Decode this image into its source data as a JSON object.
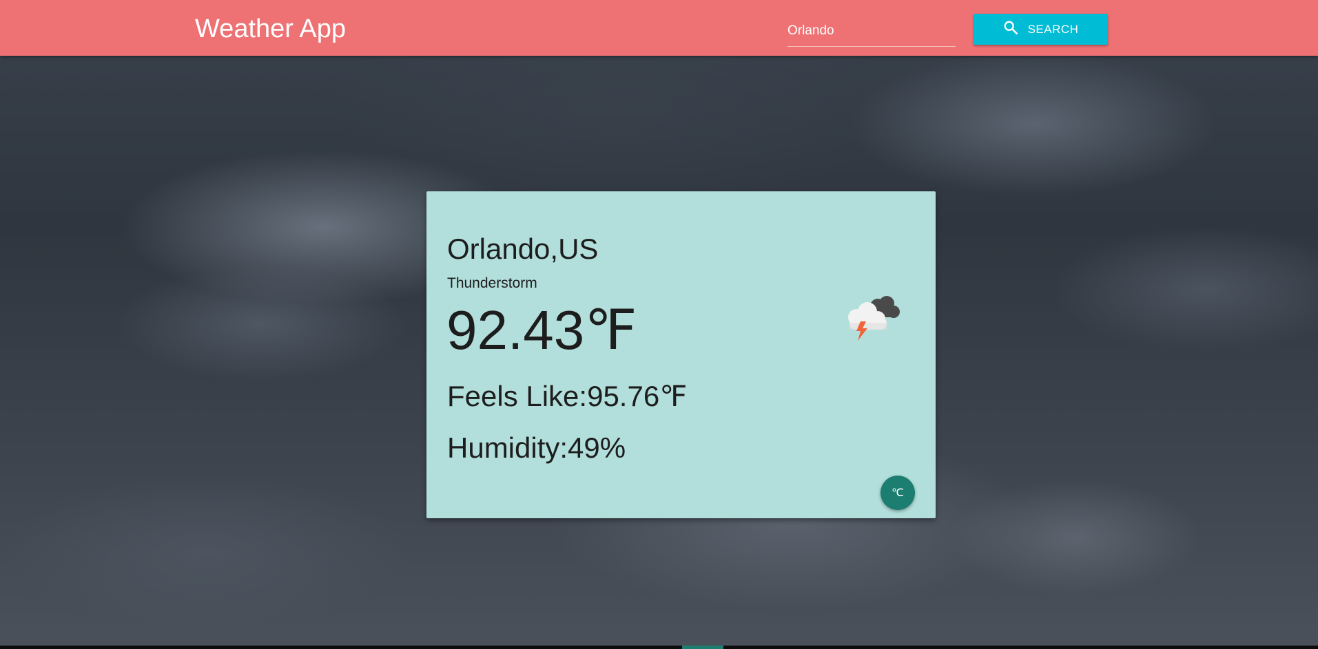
{
  "header": {
    "title": "Weather App",
    "search_value": "Orlando",
    "search_label": "SEARCH",
    "search_icon": "search-icon"
  },
  "weather": {
    "location": "Orlando,US",
    "condition": "Thunderstorm",
    "temperature": "92.43",
    "temp_unit": "℉",
    "feels_like_label": "Feels Like:",
    "feels_like_value": "95.76",
    "feels_like_unit": "℉",
    "humidity_label": "Humidity:",
    "humidity_value": "49%",
    "icon": "thunderstorm-icon"
  },
  "unit_toggle": {
    "label": "℃"
  },
  "colors": {
    "header_bg": "#ee7174",
    "search_button": "#00bcd4",
    "card_bg": "#b2dfdb",
    "toggle_bg": "#1b7e70"
  }
}
